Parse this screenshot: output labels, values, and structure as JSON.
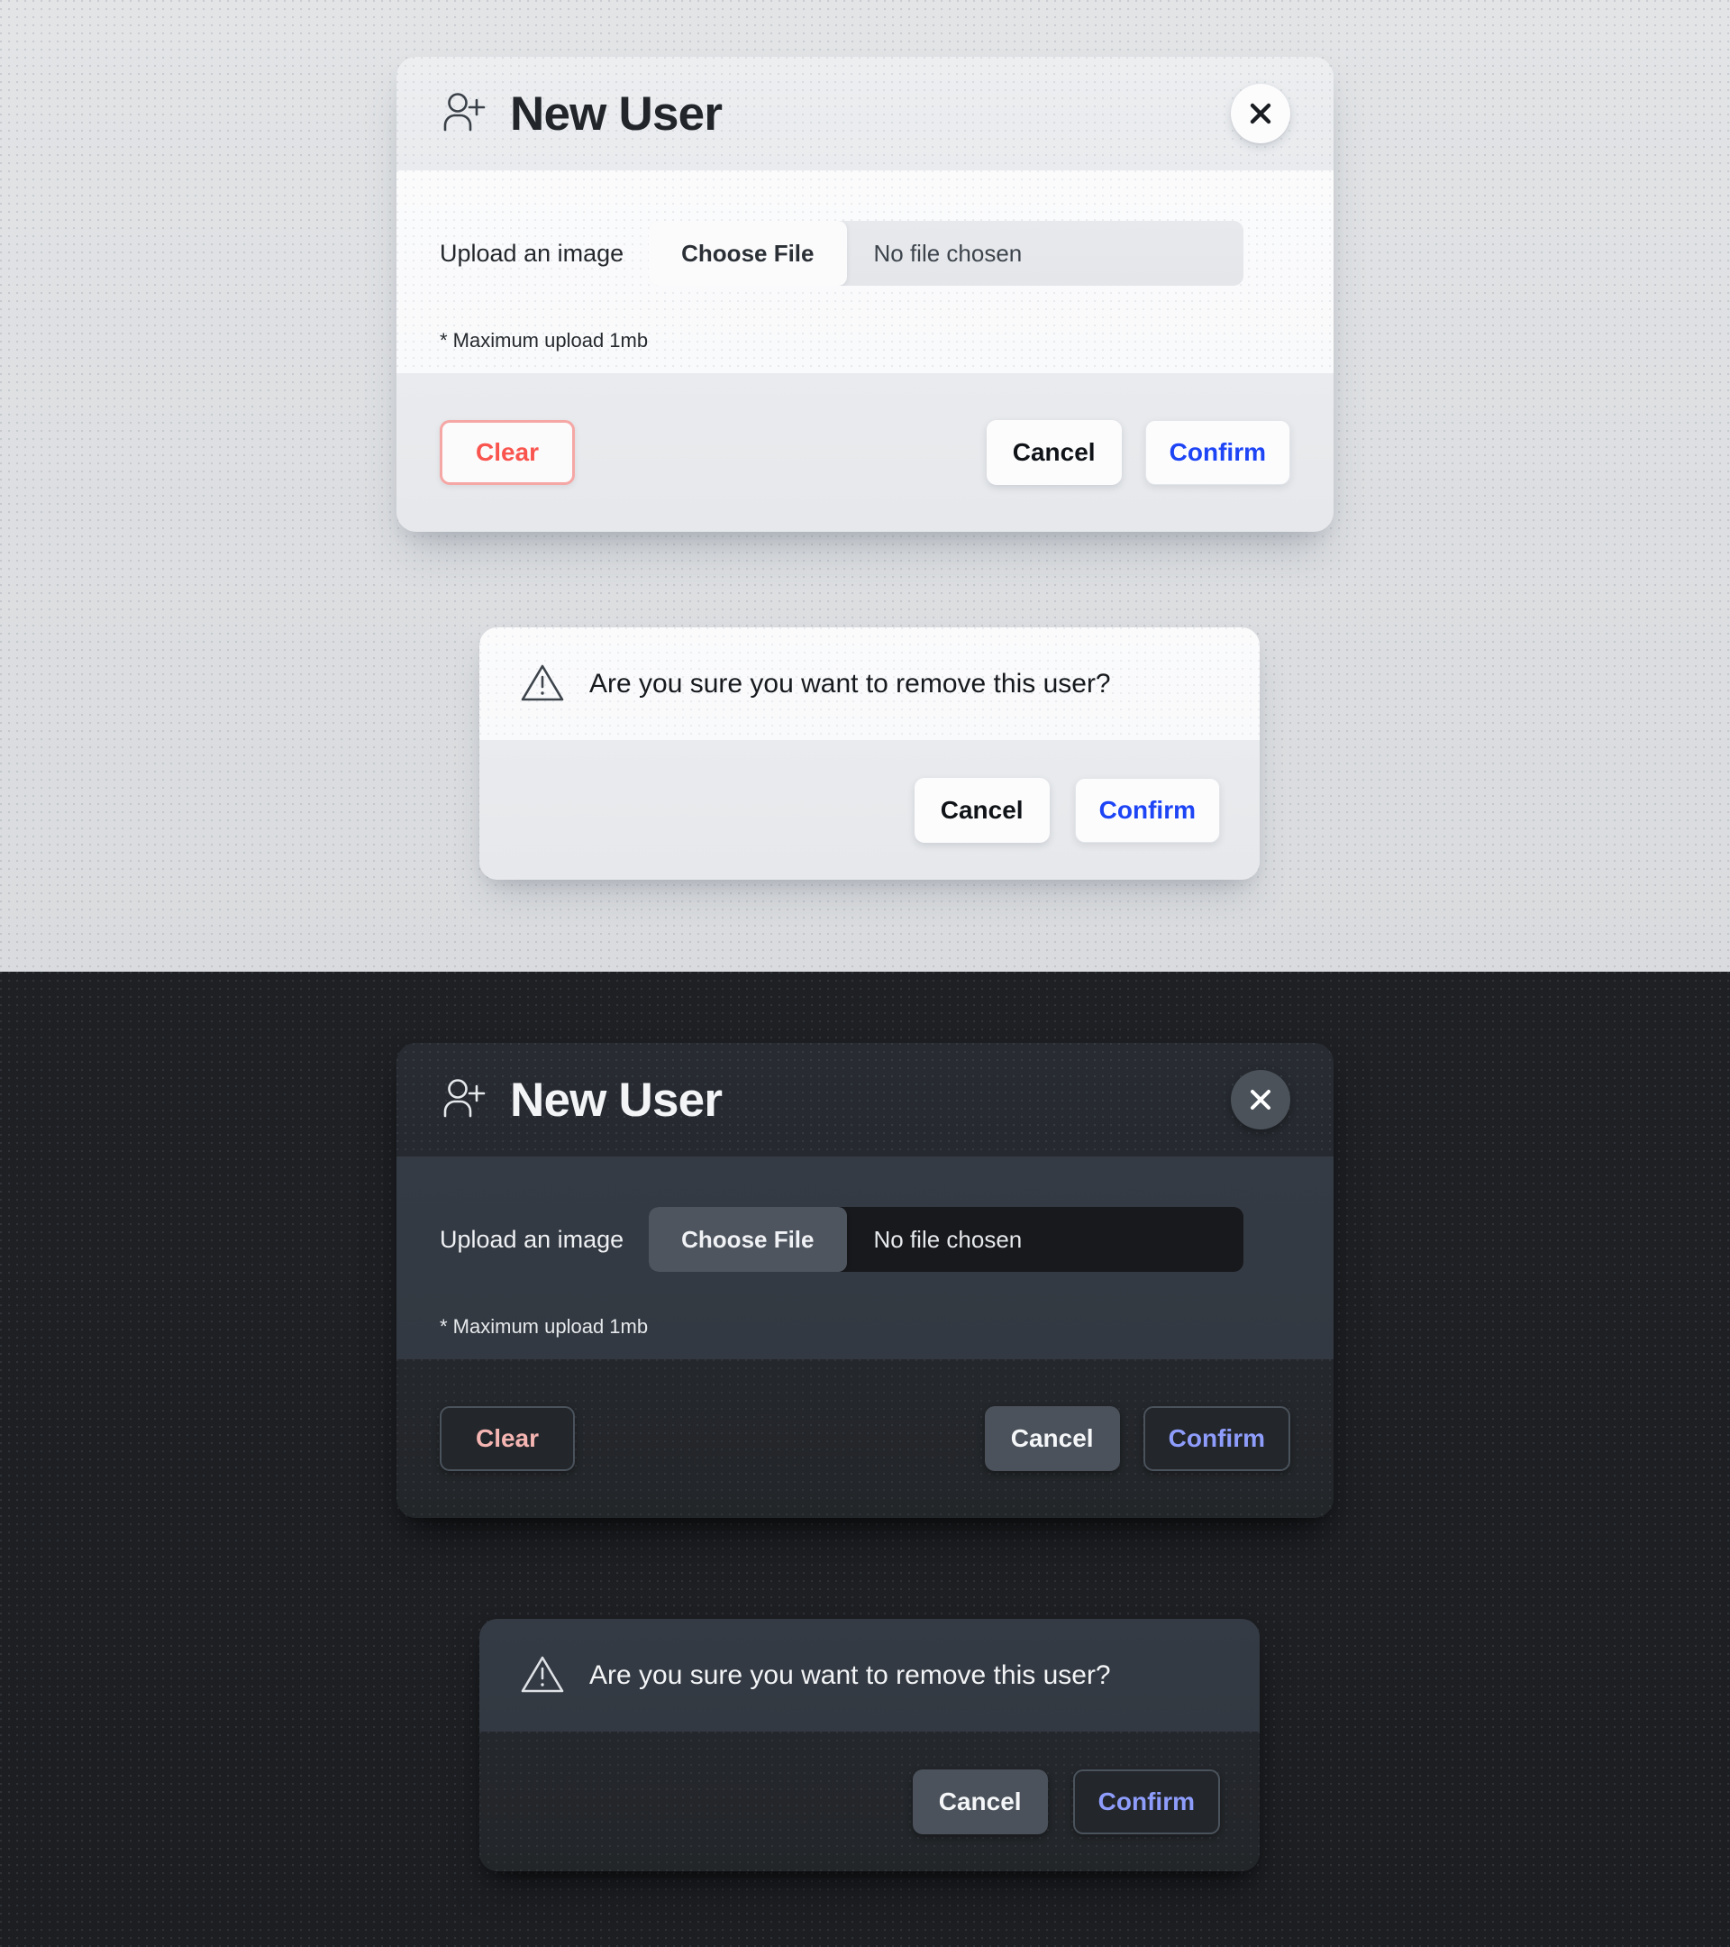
{
  "themes": {
    "light_label": "light",
    "dark_label": "dark"
  },
  "colors": {
    "accent_confirm_light": "#1d44f5",
    "accent_confirm_dark": "#8e9dfb",
    "danger_light": "#f9544e",
    "danger_dark": "#f5b5b2",
    "light_surface": "#fbfbfc",
    "light_header": "#eceef0",
    "light_footer": "#e9ebee",
    "light_page_bg": "#dcdee1",
    "dark_surface": "#353b44",
    "dark_header": "#272b31",
    "dark_footer": "#24272c",
    "dark_page_bg": "#1d1f23"
  },
  "new_user_modal": {
    "title": "New User",
    "title_icon": "user-add-icon",
    "close_icon": "close-icon",
    "upload": {
      "label": "Upload an image",
      "choose_file_label": "Choose File",
      "file_status": "No file chosen",
      "hint": "* Maximum upload 1mb"
    },
    "buttons": {
      "clear": "Clear",
      "cancel": "Cancel",
      "confirm": "Confirm"
    }
  },
  "confirm_dialog": {
    "icon": "warning-triangle-icon",
    "message": "Are you sure you want to remove this user?",
    "buttons": {
      "cancel": "Cancel",
      "confirm": "Confirm"
    }
  }
}
